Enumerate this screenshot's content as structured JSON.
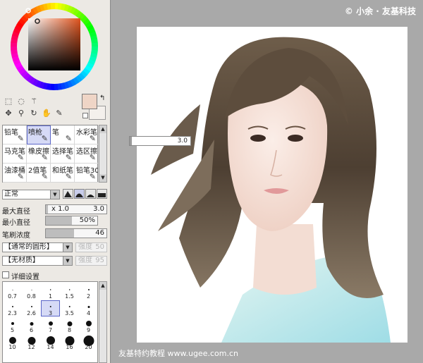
{
  "tools": {
    "row1": [
      "rect-select-icon",
      "lasso-icon",
      "magic-wand-icon"
    ],
    "row2": [
      "move-icon",
      "zoom-icon",
      "rotate-icon",
      "hand-icon",
      "eyedropper-icon"
    ]
  },
  "colors": {
    "foreground": "#efd5c6",
    "background": "#f4f0ec",
    "selection": "#d6daf6",
    "accent": "#5b66c8"
  },
  "brushes": [
    {
      "label": "铅笔",
      "icon": "pencil-icon"
    },
    {
      "label": "喷枪",
      "icon": "airbrush-icon",
      "selected": true
    },
    {
      "label": "笔",
      "icon": "pen-icon"
    },
    {
      "label": "水彩笔",
      "icon": "watercolor-icon"
    },
    {
      "label": "马克笔",
      "icon": "marker-icon"
    },
    {
      "label": "橡皮擦",
      "icon": "eraser-icon"
    },
    {
      "label": "选择笔",
      "icon": "select-pen-icon"
    },
    {
      "label": "选区擦",
      "icon": "select-eraser-icon"
    },
    {
      "label": "油漆桶",
      "icon": "bucket-icon"
    },
    {
      "label": "2值笔",
      "icon": "binary-pen-icon"
    },
    {
      "label": "和纸笔",
      "icon": "washi-pen-icon"
    },
    {
      "label": "铅笔30",
      "icon": "pencil-30-icon"
    }
  ],
  "blend_mode": "正常",
  "max_size": {
    "label": "最大直径",
    "multiplier": "x 1.0",
    "value": "3.0",
    "fill": 0.03
  },
  "min_size": {
    "label": "最小直径",
    "value": "50%",
    "fill": 0.5
  },
  "density": {
    "label": "笔刷浓度",
    "value": "46",
    "fill": 0.46
  },
  "shape": {
    "value": "【通常的圆形】",
    "strength_label": "强度",
    "strength_value": "50"
  },
  "texture": {
    "value": "【无材质】",
    "strength_label": "强度",
    "strength_value": "95"
  },
  "detail_settings": "详细设置",
  "sizes": [
    {
      "label": "0.7",
      "d": 1
    },
    {
      "label": "0.8",
      "d": 1
    },
    {
      "label": "1",
      "d": 1.5
    },
    {
      "label": "1.5",
      "d": 1.5
    },
    {
      "label": "2",
      "d": 2
    },
    {
      "label": "2.3",
      "d": 2
    },
    {
      "label": "2.6",
      "d": 2
    },
    {
      "label": "3",
      "d": 2.5,
      "selected": true
    },
    {
      "label": "3.5",
      "d": 2.5
    },
    {
      "label": "4",
      "d": 3
    },
    {
      "label": "5",
      "d": 4
    },
    {
      "label": "6",
      "d": 5
    },
    {
      "label": "7",
      "d": 6
    },
    {
      "label": "8",
      "d": 7
    },
    {
      "label": "9",
      "d": 8
    },
    {
      "label": "10",
      "d": 10
    },
    {
      "label": "12",
      "d": 11
    },
    {
      "label": "14",
      "d": 12
    },
    {
      "label": "16",
      "d": 13
    },
    {
      "label": "20",
      "d": 15
    }
  ],
  "canvas": {
    "watermark_top": "© 小余 · 友基科技",
    "watermark_bottom": "友基特约教程 www.ugee.com.cn",
    "float_value": "3.0"
  }
}
